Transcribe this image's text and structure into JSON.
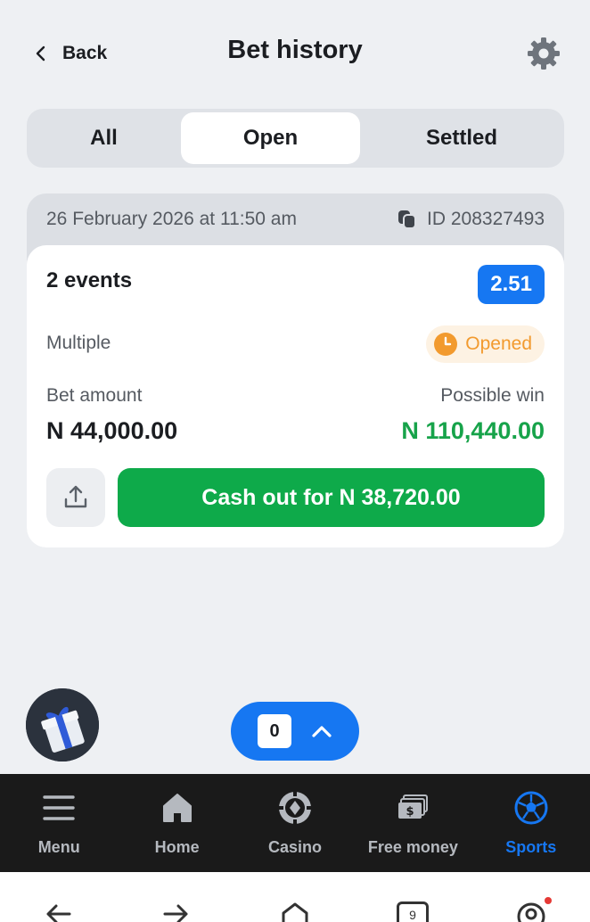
{
  "header": {
    "back_label": "Back",
    "title": "Bet history"
  },
  "tabs": {
    "all": "All",
    "open": "Open",
    "settled": "Settled",
    "active": "Open"
  },
  "bet": {
    "date": "26 February 2026 at 11:50 am",
    "id_label": "ID 208327493",
    "events": "2 events",
    "odds": "2.51",
    "type": "Multiple",
    "status": "Opened",
    "bet_amount_label": "Bet amount",
    "bet_amount": "N 44,000.00",
    "possible_win_label": "Possible win",
    "possible_win": "N 110,440.00",
    "cashout_label": "Cash out for N 38,720.00"
  },
  "betslip": {
    "count": "0"
  },
  "nav": {
    "items": [
      {
        "label": "Menu",
        "icon": "menu-icon"
      },
      {
        "label": "Home",
        "icon": "home-icon"
      },
      {
        "label": "Casino",
        "icon": "casino-chip-icon"
      },
      {
        "label": "Free money",
        "icon": "money-icon"
      },
      {
        "label": "Sports",
        "icon": "soccer-ball-icon"
      }
    ],
    "active": "Sports"
  },
  "system": {
    "tab_count": "9"
  },
  "colors": {
    "accent": "#1677f2",
    "success": "#17a34a",
    "cashout": "#0eaa4a",
    "status_open": "#f29a2e"
  }
}
